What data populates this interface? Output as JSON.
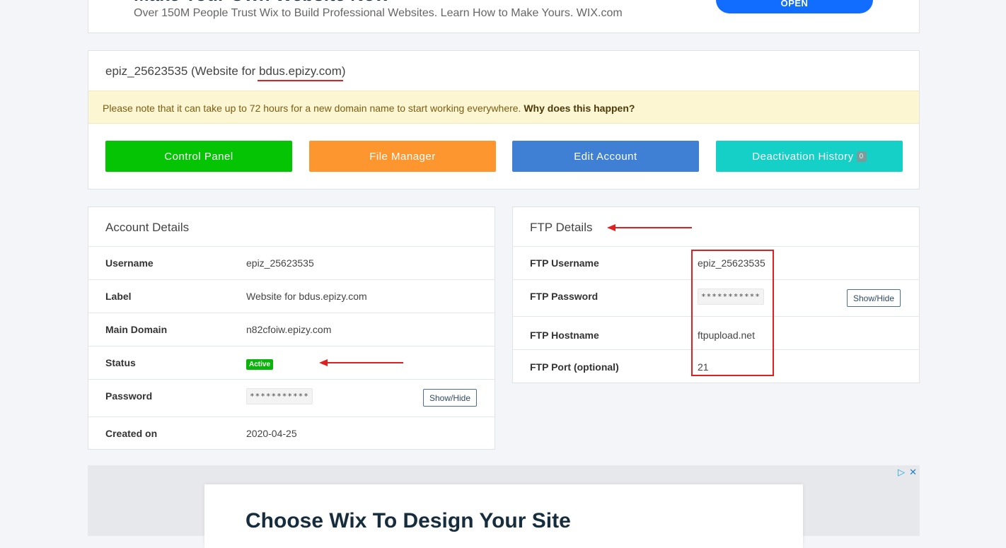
{
  "top_ad": {
    "headline": "Make Your Own Website Now",
    "subtitle": "Over 150M People Trust Wix to Build Professional Websites. Learn How to Make Yours. WIX.com",
    "cta": "OPEN"
  },
  "website": {
    "account_id": "epiz_25623535",
    "title_prefix": " (Website for ",
    "domain": "bdus.epizy.com",
    "title_suffix": ")",
    "notice_text": "Please note that it can take up to 72 hours for a new domain name to start working everywhere. ",
    "notice_link": "Why does this happen?",
    "buttons": {
      "control_panel": "Control Panel",
      "file_manager": "File Manager",
      "edit_account": "Edit Account",
      "deactivation_history": "Deactivation History",
      "deactivation_count": "0"
    }
  },
  "account_details": {
    "title": "Account Details",
    "username_label": "Username",
    "username": "epiz_25623535",
    "label_label": "Label",
    "label": "Website for bdus.epizy.com",
    "main_domain_label": "Main Domain",
    "main_domain": "n82cfoiw.epizy.com",
    "status_label": "Status",
    "status": "Active",
    "password_label": "Password",
    "password": "***********",
    "show_hide": "Show/Hide",
    "created_label": "Created on",
    "created": "2020-04-25"
  },
  "ftp_details": {
    "title": "FTP Details",
    "username_label": "FTP Username",
    "username": "epiz_25623535",
    "password_label": "FTP Password",
    "password": "***********",
    "show_hide": "Show/Hide",
    "hostname_label": "FTP Hostname",
    "hostname": "ftpupload.net",
    "port_label": "FTP Port (optional)",
    "port": "21"
  },
  "bottom_ad": {
    "headline": "Choose Wix To Design Your Site",
    "adchoices_icon": "play-triangle-icon",
    "close_icon": "close-icon"
  },
  "colors": {
    "control_panel": "#04c404",
    "file_manager": "#fd962e",
    "edit_account": "#3f80d5",
    "deactivation_history": "#14d0c6",
    "annotation_red": "#e02020"
  }
}
